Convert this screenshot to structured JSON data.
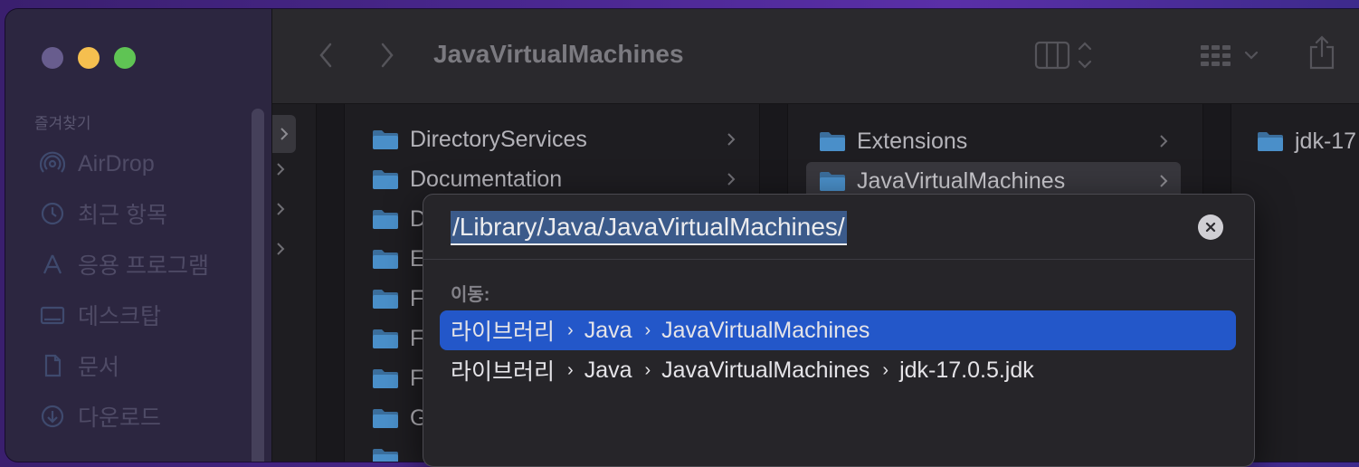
{
  "window": {
    "title": "JavaVirtualMachines"
  },
  "sidebar": {
    "section": "즐겨찾기",
    "items": [
      {
        "label": "AirDrop",
        "icon": "airdrop-icon"
      },
      {
        "label": "최근 항목",
        "icon": "clock-icon"
      },
      {
        "label": "응용 프로그램",
        "icon": "applications-icon"
      },
      {
        "label": "데스크탑",
        "icon": "desktop-icon"
      },
      {
        "label": "문서",
        "icon": "document-icon"
      },
      {
        "label": "다운로드",
        "icon": "download-icon"
      }
    ]
  },
  "columns": {
    "col1": [
      "DirectoryServices",
      "Documentation",
      "D",
      "E",
      "F",
      "F",
      "F",
      "G"
    ],
    "col2": [
      "Extensions",
      "JavaVirtualMachines"
    ],
    "col3": [
      "jdk-17"
    ]
  },
  "dialog": {
    "path": "/Library/Java/JavaVirtualMachines/",
    "goto_label": "이동:",
    "suggestions": [
      {
        "segments": [
          "라이브러리",
          "Java",
          "JavaVirtualMachines"
        ]
      },
      {
        "segments": [
          "라이브러리",
          "Java",
          "JavaVirtualMachines",
          "jdk-17.0.5.jdk"
        ]
      }
    ]
  },
  "colors": {
    "accent": "#2357c9",
    "folder": "#4a8fc9"
  }
}
